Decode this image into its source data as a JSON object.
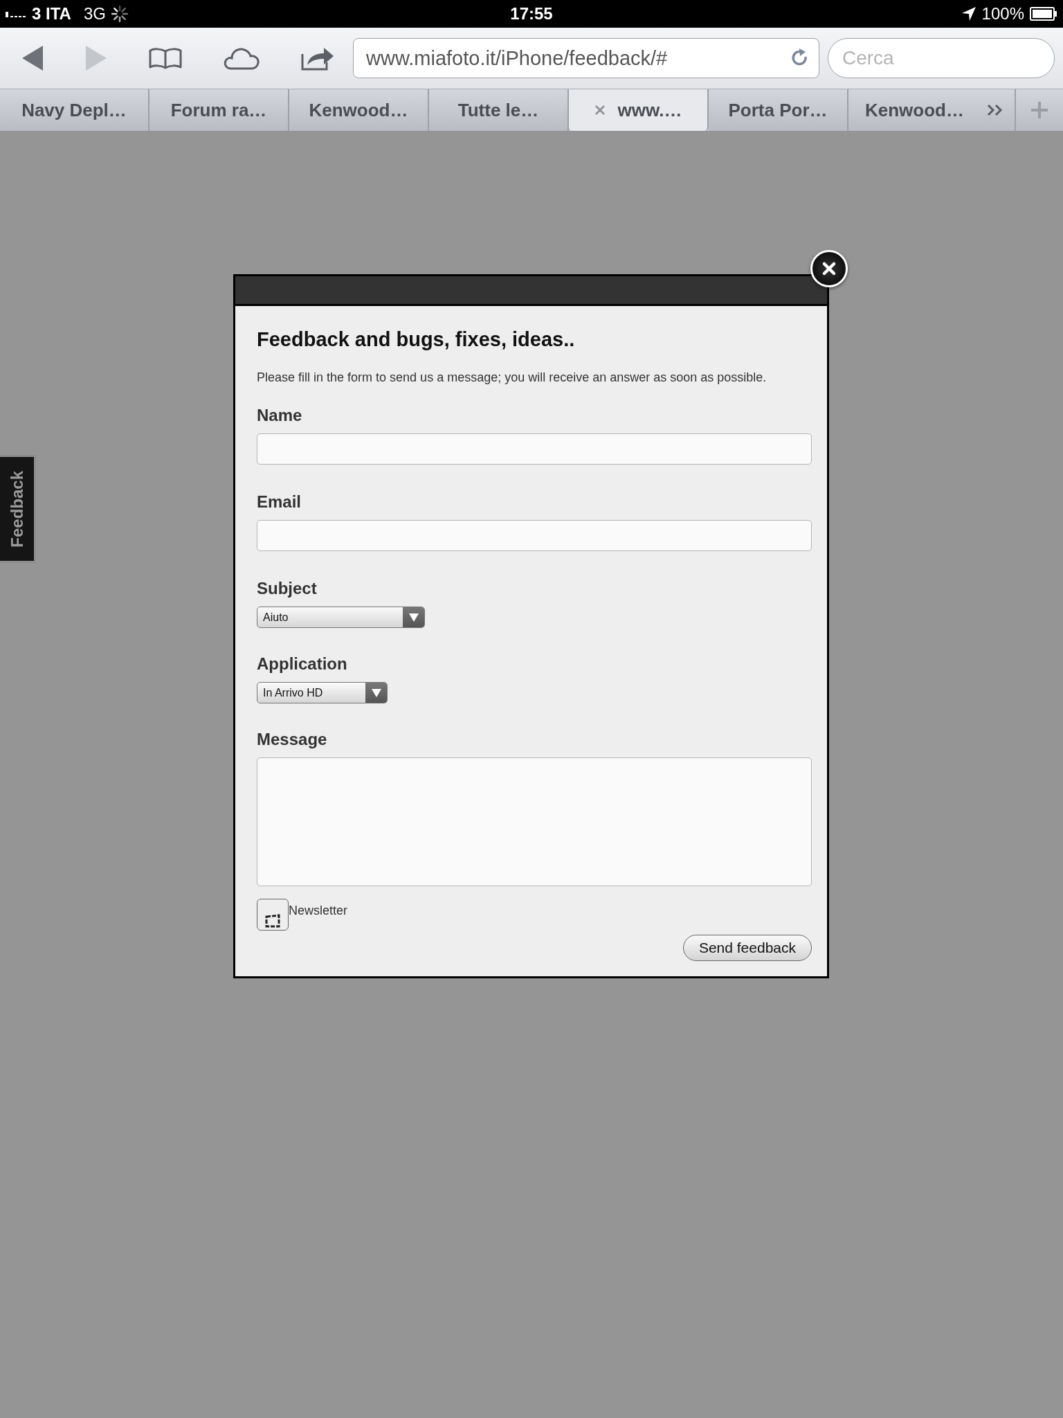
{
  "status_bar": {
    "carrier": "3 ITA",
    "network": "3G",
    "time": "17:55",
    "battery": "100%"
  },
  "toolbar": {
    "url": "www.miafoto.it/iPhone/feedback/#",
    "search_placeholder": "Cerca"
  },
  "tabs": [
    {
      "label": "Navy Depl…",
      "selected": false
    },
    {
      "label": "Forum ra…",
      "selected": false
    },
    {
      "label": "Kenwood…",
      "selected": false
    },
    {
      "label": "Tutte le…",
      "selected": false
    },
    {
      "label": "www.…",
      "selected": true
    },
    {
      "label": "Porta Por…",
      "selected": false
    },
    {
      "label": "Kenwood…",
      "selected": false
    }
  ],
  "side_tab": {
    "label": "Feedback"
  },
  "dialog": {
    "title": "Feedback and bugs, fixes, ideas..",
    "description": "Please fill in the form to send us a message; you will receive an answer as soon as possible.",
    "fields": [
      {
        "kind": "text",
        "label": "Name"
      },
      {
        "kind": "text",
        "label": "Email"
      },
      {
        "kind": "select",
        "label": "Subject",
        "value": "Aiuto"
      },
      {
        "kind": "select",
        "label": "Application",
        "value": "In Arrivo HD"
      },
      {
        "kind": "textarea",
        "label": "Message"
      }
    ],
    "newsletter": {
      "label": "Newsletter",
      "checked": false
    },
    "submit": "Send feedback"
  }
}
